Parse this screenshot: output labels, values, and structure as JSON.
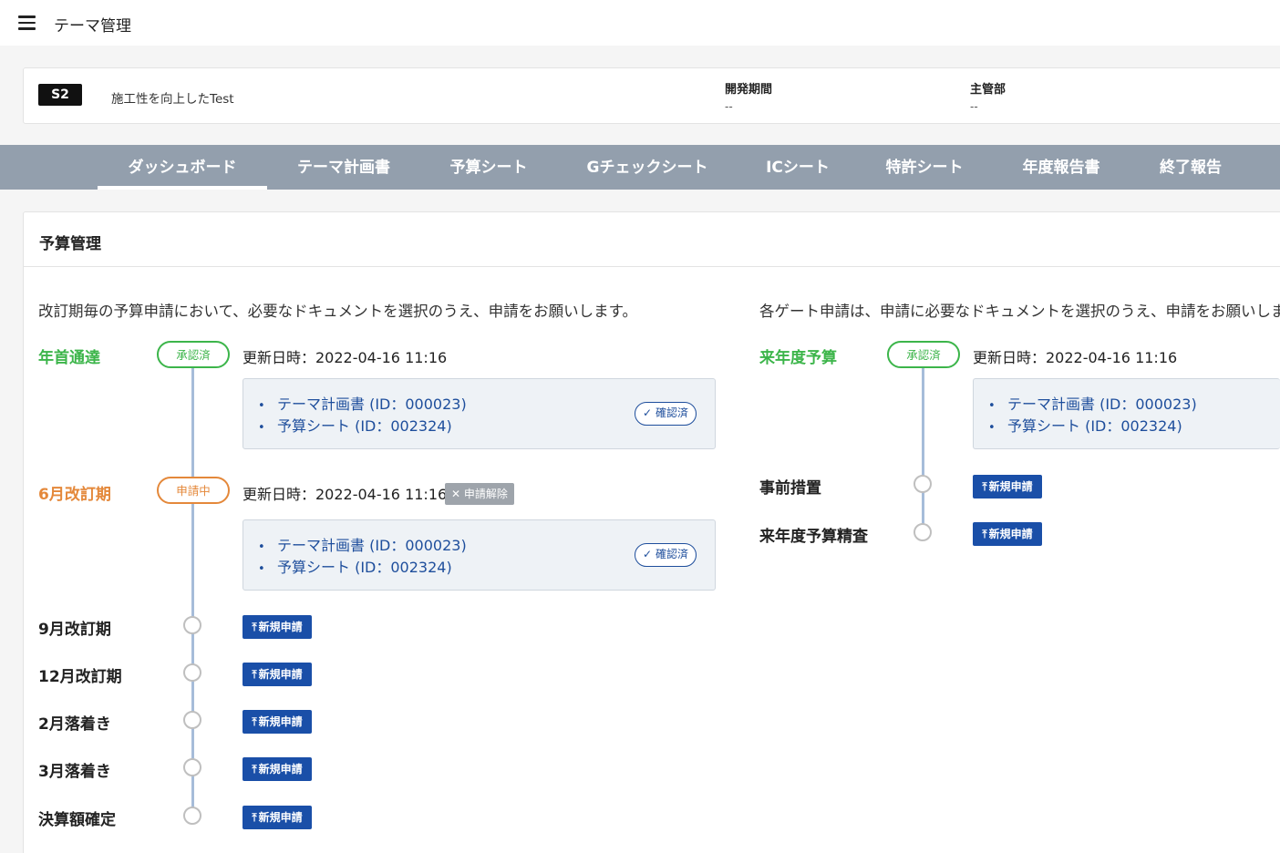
{
  "app": {
    "title": "テーマ管理"
  },
  "theme": {
    "code": "S2",
    "name": "施工性を向上したTest",
    "period_label": "開発期間",
    "period_value": "--",
    "dept_label": "主管部",
    "dept_value": "--"
  },
  "tabs": [
    {
      "label": "ダッシュボード",
      "active": true
    },
    {
      "label": "テーマ計画書"
    },
    {
      "label": "予算シート"
    },
    {
      "label": "Gチェックシート"
    },
    {
      "label": "ICシート"
    },
    {
      "label": "特許シート"
    },
    {
      "label": "年度報告書"
    },
    {
      "label": "終了報告"
    }
  ],
  "panel": {
    "title": "予算管理",
    "left": {
      "intro": "改訂期毎の予算申請において、必要なドキュメントを選択のうえ、申請をお願いします。",
      "stages": [
        {
          "label": "年首通達",
          "status": "承認済",
          "updated": "更新日時：2022-04-16 11:16",
          "docs": [
            "テーマ計画書 (ID：000023)",
            "予算シート (ID：002324)"
          ],
          "confirm": "確認済"
        },
        {
          "label": "6月改訂期",
          "status": "申請中",
          "updated": "更新日時：2022-04-16 11:16",
          "withdraw": "申請解除",
          "docs": [
            "テーマ計画書 (ID：000023)",
            "予算シート (ID：002324)"
          ],
          "confirm": "確認済"
        },
        {
          "label": "9月改訂期",
          "button": "新規申請"
        },
        {
          "label": "12月改訂期",
          "button": "新規申請"
        },
        {
          "label": "2月落着き",
          "button": "新規申請"
        },
        {
          "label": "3月落着き",
          "button": "新規申請"
        },
        {
          "label": "決算額確定",
          "button": "新規申請"
        }
      ]
    },
    "right": {
      "intro": "各ゲート申請は、申請に必要なドキュメントを選択のうえ、申請をお願いします。",
      "stages": [
        {
          "label": "来年度予算",
          "status": "承認済",
          "updated": "更新日時：2022-04-16 11:16",
          "docs": [
            "テーマ計画書 (ID：000023)",
            "予算シート (ID：002324)"
          ]
        },
        {
          "label": "事前措置",
          "button": "新規申請"
        },
        {
          "label": "来年度予算精査",
          "button": "新規申請"
        }
      ]
    }
  },
  "icons": {
    "menu": "menu-icon",
    "check": "check-icon",
    "close": "close-icon",
    "upload": "upload-icon"
  }
}
